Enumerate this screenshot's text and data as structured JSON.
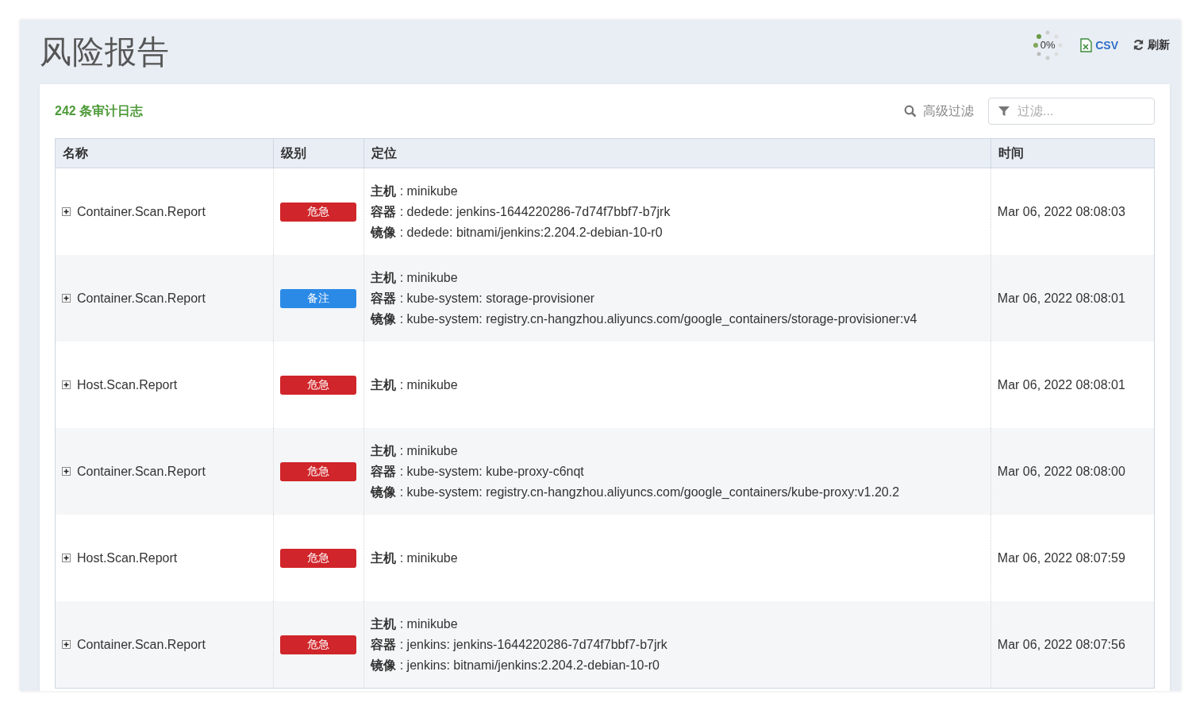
{
  "page": {
    "title": "风险报告"
  },
  "toolbar": {
    "progress_label": "0%",
    "csv_label": "CSV",
    "refresh_label": "刷新"
  },
  "card": {
    "count_label": "242 条审计日志",
    "advanced_filter": "高级过滤",
    "filter": {
      "placeholder": "过滤..."
    }
  },
  "table": {
    "columns": [
      "名称",
      "级别",
      "定位",
      "时间"
    ],
    "rows": [
      {
        "name": "Container.Scan.Report",
        "level": {
          "label": "危急",
          "kind": "critical"
        },
        "location": [
          "**主机** : minikube",
          "**容器** : dedede: jenkins-1644220286-7d74f7bbf7-b7jrk",
          "**镜像** : dedede: bitnami/jenkins:2.204.2-debian-10-r0"
        ],
        "time": "Mar 06, 2022 08:08:03"
      },
      {
        "name": "Container.Scan.Report",
        "level": {
          "label": "备注",
          "kind": "note"
        },
        "location": [
          "**主机** : minikube",
          "**容器** : kube-system: storage-provisioner",
          "**镜像** : kube-system: registry.cn-hangzhou.aliyuncs.com/google_containers/storage-provisioner:v4"
        ],
        "time": "Mar 06, 2022 08:08:01"
      },
      {
        "name": "Host.Scan.Report",
        "level": {
          "label": "危急",
          "kind": "critical"
        },
        "location": [
          "**主机** : minikube"
        ],
        "time": "Mar 06, 2022 08:08:01"
      },
      {
        "name": "Container.Scan.Report",
        "level": {
          "label": "危急",
          "kind": "critical"
        },
        "location": [
          "**主机** : minikube",
          "**容器** : kube-system: kube-proxy-c6nqt",
          "**镜像** : kube-system: registry.cn-hangzhou.aliyuncs.com/google_containers/kube-proxy:v1.20.2"
        ],
        "time": "Mar 06, 2022 08:08:00"
      },
      {
        "name": "Host.Scan.Report",
        "level": {
          "label": "危急",
          "kind": "critical"
        },
        "location": [
          "**主机** : minikube"
        ],
        "time": "Mar 06, 2022 08:07:59"
      },
      {
        "name": "Container.Scan.Report",
        "level": {
          "label": "危急",
          "kind": "critical"
        },
        "location": [
          "**主机** : minikube",
          "**容器** : jenkins: jenkins-1644220286-7d74f7bbf7-b7jrk",
          "**镜像** : jenkins: bitnami/jenkins:2.204.2-debian-10-r0"
        ],
        "time": "Mar 06, 2022 08:07:56"
      }
    ]
  }
}
